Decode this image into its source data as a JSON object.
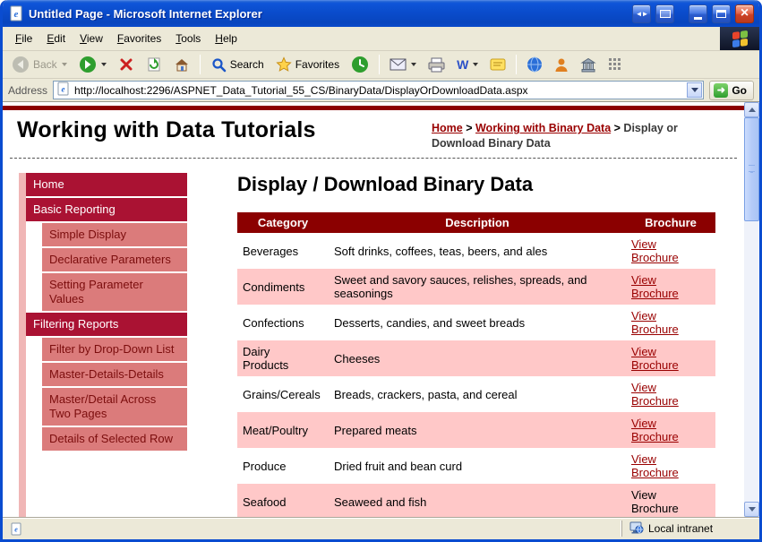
{
  "window": {
    "title": "Untitled Page - Microsoft Internet Explorer"
  },
  "icons": {
    "close": "×",
    "window_arrows": "◄►",
    "word": "W"
  },
  "menu": {
    "items": [
      "File",
      "Edit",
      "View",
      "Favorites",
      "Tools",
      "Help"
    ]
  },
  "toolbar": {
    "back_label": "Back",
    "search_label": "Search",
    "favorites_label": "Favorites"
  },
  "address": {
    "label": "Address",
    "url": "http://localhost:2296/ASPNET_Data_Tutorial_55_CS/BinaryData/DisplayOrDownloadData.aspx",
    "go_label": "Go"
  },
  "page": {
    "site_title": "Working with Data Tutorials",
    "breadcrumb_separator": ">",
    "breadcrumb": [
      {
        "label": "Home",
        "link": true
      },
      {
        "label": "Working with Binary Data",
        "link": true
      },
      {
        "label": "Display or Download Binary Data",
        "link": false
      }
    ],
    "heading": "Display / Download Binary Data",
    "sidebar": [
      {
        "label": "Home",
        "level": 1
      },
      {
        "label": "Basic Reporting",
        "level": 1
      },
      {
        "label": "Simple Display",
        "level": 2
      },
      {
        "label": "Declarative Parameters",
        "level": 2
      },
      {
        "label": "Setting Parameter Values",
        "level": 2
      },
      {
        "label": "Filtering Reports",
        "level": 1
      },
      {
        "label": "Filter by Drop-Down List",
        "level": 2
      },
      {
        "label": "Master-Details-Details",
        "level": 2
      },
      {
        "label": "Master/Detail Across Two Pages",
        "level": 2
      },
      {
        "label": "Details of Selected Row",
        "level": 2
      }
    ],
    "table": {
      "headers": [
        "Category",
        "Description",
        "Brochure"
      ],
      "rows": [
        {
          "category": "Beverages",
          "description": "Soft drinks, coffees, teas, beers, and ales",
          "brochure": "View\nBrochure",
          "link": true
        },
        {
          "category": "Condiments",
          "description": "Sweet and savory sauces, relishes, spreads, and seasonings",
          "brochure": "View\nBrochure",
          "link": true
        },
        {
          "category": "Confections",
          "description": "Desserts, candies, and sweet breads",
          "brochure": "View\nBrochure",
          "link": true
        },
        {
          "category": "Dairy\nProducts",
          "description": "Cheeses",
          "brochure": "View\nBrochure",
          "link": true
        },
        {
          "category": "Grains/Cereals",
          "description": "Breads, crackers, pasta, and cereal",
          "brochure": "View\nBrochure",
          "link": true
        },
        {
          "category": "Meat/Poultry",
          "description": "Prepared meats",
          "brochure": "View\nBrochure",
          "link": true
        },
        {
          "category": "Produce",
          "description": "Dried fruit and bean curd",
          "brochure": "View\nBrochure",
          "link": true
        },
        {
          "category": "Seafood",
          "description": "Seaweed and fish",
          "brochure": "View\nBrochure",
          "link": false
        }
      ]
    }
  },
  "status": {
    "zone": "Local intranet"
  },
  "colors": {
    "accent_dark": "#8B0000",
    "link": "#990000",
    "row_alt": "#FFC8C8",
    "sidebar_level1": "#AA1233",
    "sidebar_level2": "#DB7B7B",
    "sidebar_strip": "#F0B6B6",
    "titlebar_blue": "#0A4CCC"
  }
}
